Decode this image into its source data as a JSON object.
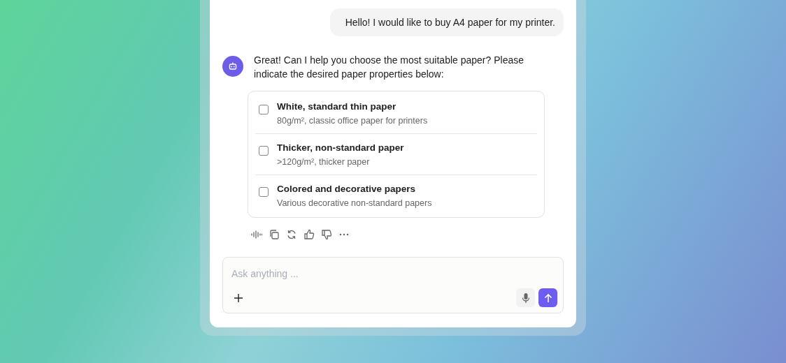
{
  "messages": [
    {
      "kind": "user",
      "text": "Hello! I would like to buy A4 paper for my printer."
    },
    {
      "kind": "bot",
      "text": "Great! Can I help you choose the most suitable paper? Please indicate the desired paper properties below:",
      "options": [
        {
          "title": "White, standard thin paper",
          "description": "80g/m², classic office paper for printers",
          "checked": false
        },
        {
          "title": "Thicker, non-standard paper",
          "description": ">120g/m², thicker paper",
          "checked": false
        },
        {
          "title": "Colored and decorative papers",
          "description": "Various decorative non-standard papers",
          "checked": false
        }
      ]
    }
  ],
  "composer": {
    "placeholder": "Ask anything ..."
  }
}
